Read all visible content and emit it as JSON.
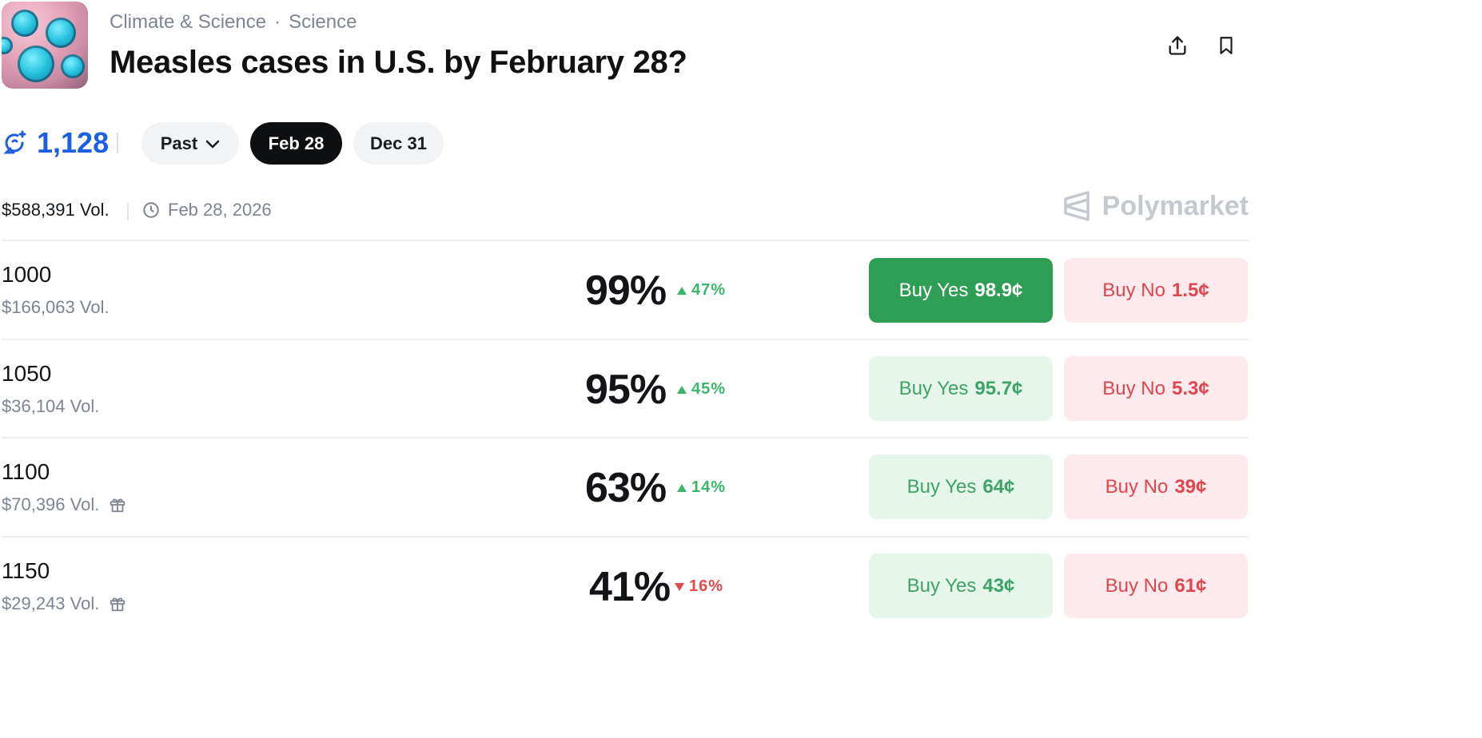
{
  "header": {
    "category": "Climate & Science",
    "separator": "·",
    "subcategory": "Science",
    "title": "Measles cases in U.S. by February 28?"
  },
  "stats": {
    "comment_count": "1,128"
  },
  "date_tabs": [
    {
      "label": "Past",
      "active": false
    },
    {
      "label": "Feb 28",
      "active": true
    },
    {
      "label": "Dec 31",
      "active": false
    }
  ],
  "meta": {
    "volume": "$588,391 Vol.",
    "end_date": "Feb 28, 2026"
  },
  "brand": {
    "name": "Polymarket"
  },
  "outcomes": [
    {
      "label": "1000",
      "volume": "$166,063 Vol.",
      "gift": false,
      "probability": "99%",
      "change": "47%",
      "direction": "up",
      "yes_label": "Buy Yes",
      "yes_price": "98.9¢",
      "no_label": "Buy No",
      "no_price": "1.5¢"
    },
    {
      "label": "1050",
      "volume": "$36,104 Vol.",
      "gift": false,
      "probability": "95%",
      "change": "45%",
      "direction": "up",
      "yes_label": "Buy Yes",
      "yes_price": "95.7¢",
      "no_label": "Buy No",
      "no_price": "5.3¢"
    },
    {
      "label": "1100",
      "volume": "$70,396 Vol.",
      "gift": true,
      "probability": "63%",
      "change": "14%",
      "direction": "up",
      "yes_label": "Buy Yes",
      "yes_price": "64¢",
      "no_label": "Buy No",
      "no_price": "39¢"
    },
    {
      "label": "1150",
      "volume": "$29,243 Vol.",
      "gift": true,
      "probability": "41%",
      "change": "16%",
      "direction": "down",
      "yes_label": "Buy Yes",
      "yes_price": "43¢",
      "no_label": "Buy No",
      "no_price": "61¢"
    }
  ],
  "colors": {
    "accent_blue": "#1c5fe0",
    "yes_green": "#2f9e55",
    "no_red": "#e1454f"
  },
  "icons": [
    "market-thumbnail",
    "share-icon",
    "bookmark-icon",
    "comments-icon",
    "chevron-down-icon",
    "clock-icon",
    "polymarket-logo-icon",
    "gift-icon",
    "triangle-up-icon",
    "triangle-down-icon"
  ]
}
